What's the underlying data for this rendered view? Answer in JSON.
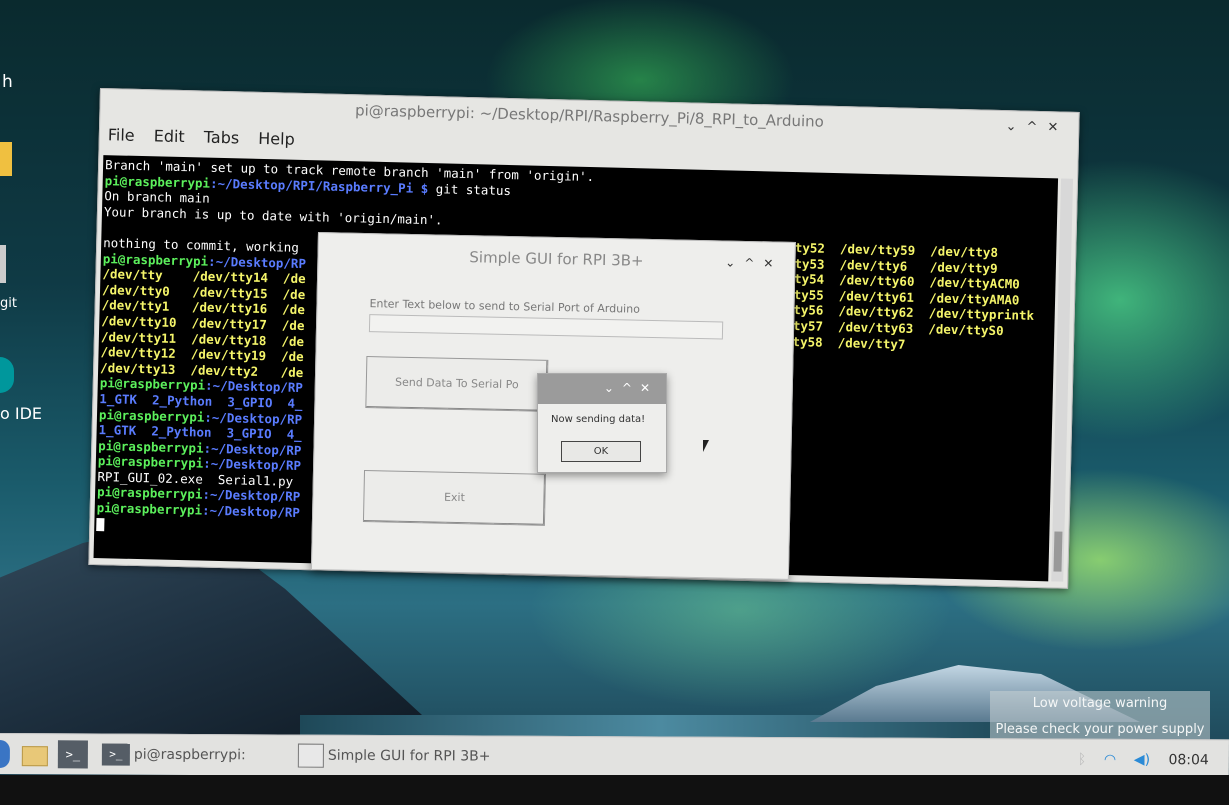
{
  "desktop": {
    "icons": {
      "partial_letter": "h",
      "git_label": "git",
      "ide_label": "o IDE"
    }
  },
  "terminal": {
    "title": "pi@raspberrypi: ~/Desktop/RPI/Raspberry_Pi/8_RPI_to_Arduino",
    "controls": [
      "⌄",
      "^",
      "✕"
    ],
    "menu": [
      "File",
      "Edit",
      "Tabs",
      "Help"
    ],
    "lines": [
      {
        "segs": [
          {
            "t": "Branch 'main' set up to track remote branch 'main' from 'origin'.",
            "c": "w"
          }
        ]
      },
      {
        "segs": [
          {
            "t": "pi@raspberrypi",
            "c": "g"
          },
          {
            "t": ":~/Desktop/RPI/Raspberry_Pi $",
            "c": "b"
          },
          {
            "t": " git status",
            "c": "w"
          }
        ]
      },
      {
        "segs": [
          {
            "t": "On branch main",
            "c": "w"
          }
        ]
      },
      {
        "segs": [
          {
            "t": "Your branch is up to date with 'origin/main'.",
            "c": "w"
          }
        ]
      },
      {
        "segs": [
          {
            "t": "",
            "c": "w"
          }
        ]
      },
      {
        "segs": [
          {
            "t": "nothing to commit, working",
            "c": "w"
          }
        ]
      },
      {
        "segs": [
          {
            "t": "pi@raspberrypi",
            "c": "g"
          },
          {
            "t": ":~/Desktop/RP",
            "c": "b"
          }
        ]
      },
      {
        "segs": [
          {
            "t": "/dev/tty    /dev/tty14  /de",
            "c": "y"
          }
        ]
      },
      {
        "segs": [
          {
            "t": "/dev/tty0   /dev/tty15  /de",
            "c": "y"
          }
        ]
      },
      {
        "segs": [
          {
            "t": "/dev/tty1   /dev/tty16  /de",
            "c": "y"
          }
        ]
      },
      {
        "segs": [
          {
            "t": "/dev/tty10  /dev/tty17  /de",
            "c": "y"
          }
        ]
      },
      {
        "segs": [
          {
            "t": "/dev/tty11  /dev/tty18  /de",
            "c": "y"
          }
        ]
      },
      {
        "segs": [
          {
            "t": "/dev/tty12  /dev/tty19  /de",
            "c": "y"
          }
        ]
      },
      {
        "segs": [
          {
            "t": "/dev/tty13  /dev/tty2   /de",
            "c": "y"
          }
        ]
      },
      {
        "segs": [
          {
            "t": "pi@raspberrypi",
            "c": "g"
          },
          {
            "t": ":~/Desktop/RP",
            "c": "b"
          }
        ]
      },
      {
        "segs": [
          {
            "t": "1_GTK  2_Python  3_GPIO  4_",
            "c": "b"
          }
        ]
      },
      {
        "segs": [
          {
            "t": "pi@raspberrypi",
            "c": "g"
          },
          {
            "t": ":~/Desktop/RP",
            "c": "b"
          }
        ]
      },
      {
        "segs": [
          {
            "t": "1_GTK  2_Python  3_GPIO  4_",
            "c": "b"
          }
        ]
      },
      {
        "segs": [
          {
            "t": "pi@raspberrypi",
            "c": "g"
          },
          {
            "t": ":~/Desktop/RP",
            "c": "b"
          }
        ]
      },
      {
        "segs": [
          {
            "t": "pi@raspberrypi",
            "c": "g"
          },
          {
            "t": ":~/Desktop/RP",
            "c": "b"
          }
        ]
      },
      {
        "segs": [
          {
            "t": "RPI_GUI_02.exe  Serial1.py",
            "c": "w"
          }
        ]
      },
      {
        "segs": [
          {
            "t": "pi@raspberrypi",
            "c": "g"
          },
          {
            "t": ":~/Desktop/RP",
            "c": "b"
          }
        ]
      },
      {
        "segs": [
          {
            "t": "pi@raspberrypi",
            "c": "g"
          },
          {
            "t": ":~/Desktop/RP",
            "c": "b"
          }
        ]
      }
    ],
    "right_columns": [
      "tty52  /dev/tty59  /dev/tty8",
      "tty53  /dev/tty6   /dev/tty9",
      "tty54  /dev/tty60  /dev/ttyACM0",
      "tty55  /dev/tty61  /dev/ttyAMA0",
      "tty56  /dev/tty62  /dev/ttyprintk",
      "tty57  /dev/tty63  /dev/ttyS0",
      "tty58  /dev/tty7"
    ],
    "partial_chars": [
      "d",
      "d"
    ]
  },
  "gui": {
    "title": "Simple GUI for RPI 3B+",
    "controls": [
      "⌄",
      "^",
      "✕"
    ],
    "entry_label": "Enter Text below to send to Serial Port of Arduino",
    "entry_value": "",
    "send_button": "Send Data To Serial Po",
    "exit_button": "Exit"
  },
  "message_box": {
    "controls": [
      "⌄",
      "^",
      "✕"
    ],
    "text": "Now sending data!",
    "ok_button": "OK"
  },
  "notification": {
    "line1": "Low voltage warning",
    "line2": "Please check your power supply"
  },
  "taskbar": {
    "terminal_icon": ">_",
    "task1_label": "pi@raspberrypi: ~/De...",
    "task2_label": "Simple GUI for RPI 3B+",
    "tray_icons": [
      "bluetooth-icon",
      "wifi-icon",
      "volume-icon"
    ],
    "clock": "08:04"
  }
}
